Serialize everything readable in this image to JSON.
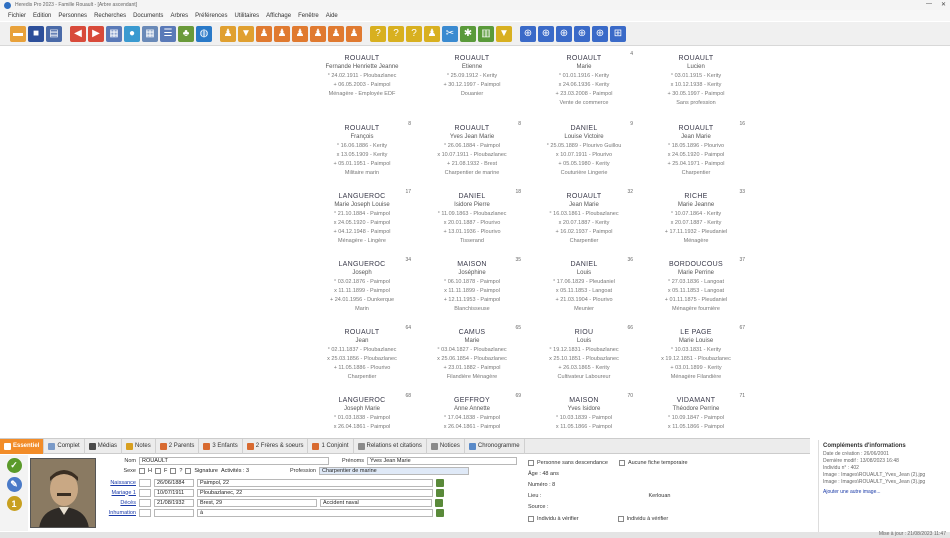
{
  "window": {
    "title": "Heredis Pro 2023 - Famille Rouault - [Arbre ascendant]",
    "minimize": "—",
    "close": "✕"
  },
  "menu": [
    "Fichier",
    "Edition",
    "Personnes",
    "Recherches",
    "Documents",
    "Arbres",
    "Préférences",
    "Utilitaires",
    "Affichage",
    "Fenêtre",
    "Aide"
  ],
  "toolbar": [
    {
      "icon": "open-folder-icon",
      "color": "#e8a13a"
    },
    {
      "icon": "save-icon",
      "color": "#2d4f9a"
    },
    {
      "icon": "print-icon",
      "color": "#4a6aa8"
    },
    {
      "icon": "back-arrow-icon",
      "color": "#d84a3a"
    },
    {
      "icon": "forward-arrow-icon",
      "color": "#d84a3a"
    },
    {
      "icon": "page-icon",
      "color": "#5a7ab8"
    },
    {
      "icon": "globe-icon",
      "color": "#3a9ad0"
    },
    {
      "icon": "grid-icon",
      "color": "#6a8ab8"
    },
    {
      "icon": "list-icon",
      "color": "#5a7ab8"
    },
    {
      "icon": "tree-icon",
      "color": "#6a9a3a"
    },
    {
      "icon": "world-icon",
      "color": "#2a7ac8"
    },
    {
      "icon": "family-icon",
      "color": "#e0a030"
    },
    {
      "icon": "filter-icon",
      "color": "#e0a030"
    },
    {
      "icon": "couple-icon",
      "color": "#e07a30"
    },
    {
      "icon": "couple-icon",
      "color": "#e07a30"
    },
    {
      "icon": "couple-icon",
      "color": "#e07a30"
    },
    {
      "icon": "couple-icon",
      "color": "#e07a30"
    },
    {
      "icon": "couple-icon",
      "color": "#e07a30"
    },
    {
      "icon": "couple-icon",
      "color": "#e07a30"
    },
    {
      "icon": "question-icon",
      "color": "#d8b020"
    },
    {
      "icon": "question-icon",
      "color": "#d8b020"
    },
    {
      "icon": "question-icon",
      "color": "#d8b020"
    },
    {
      "icon": "people-icon",
      "color": "#d8b020"
    },
    {
      "icon": "tools-icon",
      "color": "#3a8ad0"
    },
    {
      "icon": "gear-icon",
      "color": "#5a9a3a"
    },
    {
      "icon": "chart-icon",
      "color": "#5a9a3a"
    },
    {
      "icon": "filter-icon",
      "color": "#d8b020"
    },
    {
      "icon": "zoom-icon",
      "color": "#3a6ac8"
    },
    {
      "icon": "zoom-icon",
      "color": "#3a6ac8"
    },
    {
      "icon": "zoom-icon",
      "color": "#3a6ac8"
    },
    {
      "icon": "zoom-icon",
      "color": "#3a6ac8"
    },
    {
      "icon": "zoom-icon",
      "color": "#3a6ac8"
    },
    {
      "icon": "fit-icon",
      "color": "#3a6ac8"
    }
  ],
  "cards": [
    {
      "name": "ROUAULT",
      "first": "Fernande Henriette Jeanne",
      "lines": [
        "° 24.02.1911 - Ploubazlanec",
        "",
        "+ 06.05.2003 - Paimpol",
        "Ménagère - Employée EDF"
      ],
      "num": ""
    },
    {
      "name": "ROUAULT",
      "first": "Etienne",
      "lines": [
        "° 25.09.1912 - Kerity",
        "",
        "+ 30.12.1997 - Paimpol",
        "Douanier"
      ],
      "num": ""
    },
    {
      "name": "ROUAULT",
      "first": "Marie",
      "lines": [
        "° 01.01.1916 - Kerity",
        "x 24.06.1936 - Kerity",
        "+ 23.03.2008 - Paimpol",
        "Vente de commerce"
      ],
      "num": "4"
    },
    {
      "name": "ROUAULT",
      "first": "Lucien",
      "lines": [
        "° 03.01.1915 - Kerity",
        "x 10.12.1938 - Kerity",
        "+ 30.05.1997 - Paimpol",
        "Sans profession"
      ],
      "num": ""
    },
    {
      "name": "ROUAULT",
      "first": "François",
      "lines": [
        "° 16.06.1886 - Kerity",
        "x 13.05.1909 - Kerity",
        "+ 05.01.1951 - Paimpol",
        "Militaire marin"
      ],
      "num": "8"
    },
    {
      "name": "ROUAULT",
      "first": "Yves Jean Marie",
      "lines": [
        "° 26.06.1884 - Paimpol",
        "x 10.07.1911 - Ploubazlanec",
        "+ 21.08.1932 - Brest",
        "Charpentier de marine"
      ],
      "num": "8"
    },
    {
      "name": "DANIEL",
      "first": "Louise Victoire",
      "lines": [
        "° 25.05.1889 - Plourivo Guillou",
        "x 10.07.1911 - Plourivo",
        "+ 05.05.1980 - Kerity",
        "Couturière Lingerie"
      ],
      "num": "9"
    },
    {
      "name": "ROUAULT",
      "first": "Jean Marie",
      "lines": [
        "° 18.05.1896 - Plourivo",
        "x 24.05.1920 - Paimpol",
        "+ 25.04.1971 - Paimpol",
        "Charpentier"
      ],
      "num": "16"
    },
    {
      "name": "LANGUEROC",
      "first": "Marie Joseph Louise",
      "lines": [
        "° 21.10.1884 - Paimpol",
        "x 24.05.1920 - Paimpol",
        "+ 04.12.1948 - Paimpol",
        "Ménagère - Lingère"
      ],
      "num": "17"
    },
    {
      "name": "DANIEL",
      "first": "Isidore Pierre",
      "lines": [
        "° 11.09.1863 - Ploubazlanec",
        "x 20.01.1887 - Plourivo",
        "+ 13.01.1936 - Plourivo",
        "Tisserand"
      ],
      "num": "18"
    },
    {
      "name": "ROUAULT",
      "first": "Jean Marie",
      "lines": [
        "° 16.03.1861 - Ploubazlanec",
        "x 20.07.1887 - Kerity",
        "+ 16.02.1937 - Paimpol",
        "Charpentier"
      ],
      "num": "32"
    },
    {
      "name": "RICHE",
      "first": "Marie Jeanne",
      "lines": [
        "° 10.07.1864 - Kerity",
        "x 20.07.1887 - Kerity",
        "+ 17.11.1932 - Pleudaniel",
        "Ménagère"
      ],
      "num": "33"
    },
    {
      "name": "LANGUEROC",
      "first": "Joseph",
      "lines": [
        "° 03.02.1876 - Paimpol",
        "x 11.11.1899 - Paimpol",
        "+ 24.01.1956 - Dunkerque",
        "Marin"
      ],
      "num": "34"
    },
    {
      "name": "MAISON",
      "first": "Joséphine",
      "lines": [
        "° 06.10.1878 - Paimpol",
        "x 11.11.1899 - Paimpol",
        "+ 12.11.1953 - Paimpol",
        "Blanchisseuse"
      ],
      "num": "35"
    },
    {
      "name": "DANIEL",
      "first": "Louis",
      "lines": [
        "° 17.06.1829 - Pleudaniel",
        "x 05.11.1853 - Langoat",
        "+ 21.03.1904 - Plourivo",
        "Meunier"
      ],
      "num": "36"
    },
    {
      "name": "BORDOUCOUS",
      "first": "Marie Perrine",
      "lines": [
        "° 27.03.1836 - Langoat",
        "x 05.11.1853 - Langoat",
        "+ 01.11.1875 - Pleudaniel",
        "Ménagère fournière"
      ],
      "num": "37"
    },
    {
      "name": "ROUAULT",
      "first": "Jean",
      "lines": [
        "° 02.11.1837 - Ploubazlanec",
        "x 25.03.1856 - Ploubazlanec",
        "+ 11.05.1886 - Plourivo",
        "Charpentier"
      ],
      "num": "64"
    },
    {
      "name": "CAMUS",
      "first": "Marie",
      "lines": [
        "° 03.04.1827 - Ploubazlanec",
        "x 25.06.1854 - Ploubazlanec",
        "+ 23.01.1882 - Paimpol",
        "Filandière Ménagère"
      ],
      "num": "65"
    },
    {
      "name": "RIOU",
      "first": "Louis",
      "lines": [
        "° 19.12.1831 - Ploubazlanec",
        "x 25.10.1851 - Ploubazlanec",
        "+ 26.03.1865 - Kerity",
        "Cultivateur Laboureur"
      ],
      "num": "66"
    },
    {
      "name": "LE PAGE",
      "first": "Marie Louise",
      "lines": [
        "° 10.03.1831 - Kerity",
        "x 19.12.1851 - Ploubazlanec",
        "+ 03.01.1899 - Kerity",
        "Ménagère Filandière"
      ],
      "num": "67"
    },
    {
      "name": "LANGUEROC",
      "first": "Joseph Marie",
      "lines": [
        "° 01.03.1838 - Paimpol",
        "x 26.04.1861 - Paimpol"
      ],
      "num": "68"
    },
    {
      "name": "GEFFROY",
      "first": "Anne Annette",
      "lines": [
        "° 17.04.1838 - Paimpol",
        "x 26.04.1861 - Paimpol"
      ],
      "num": "69"
    },
    {
      "name": "MAISON",
      "first": "Yves Isidore",
      "lines": [
        "° 10.03.1839 - Paimpol",
        "x 11.05.1866 - Paimpol"
      ],
      "num": "70"
    },
    {
      "name": "VIDAMANT",
      "first": "Théodore Perrine",
      "lines": [
        "° 10.09.1847 - Paimpol",
        "x 11.05.1866 - Paimpol"
      ],
      "num": "71"
    }
  ],
  "tabs": [
    {
      "label": "Essentiel",
      "color": "#f28c28",
      "active": true
    },
    {
      "label": "Complet",
      "color": "#7a9ac8",
      "active": false
    },
    {
      "label": "Médias",
      "color": "#4a4a4a",
      "active": false
    },
    {
      "label": "Notes",
      "color": "#d8a020",
      "active": false
    },
    {
      "label": "2 Parents",
      "color": "#d86a30",
      "active": false
    },
    {
      "label": "3 Enfants",
      "color": "#d86a30",
      "active": false
    },
    {
      "label": "2 Frères & soeurs",
      "color": "#d86a30",
      "active": false
    },
    {
      "label": "1 Conjoint",
      "color": "#d86a30",
      "active": false
    },
    {
      "label": "Relations et citations",
      "color": "#8a8a8a",
      "active": false
    },
    {
      "label": "Notices",
      "color": "#8a8a8a",
      "active": false
    },
    {
      "label": "Chronogramme",
      "color": "#5a8ac8",
      "active": false
    }
  ],
  "left_strip": [
    {
      "icon": "check-icon",
      "glyph": "✓",
      "color": "#5a9a2a"
    },
    {
      "icon": "edit-icon",
      "glyph": "✎",
      "color": "#4a7ac8"
    },
    {
      "icon": "number-one-icon",
      "glyph": "1",
      "color": "#c8a020"
    }
  ],
  "form": {
    "nom_label": "Nom",
    "nom_value": "ROUAULT",
    "prenoms_label": "Prénoms",
    "prenoms_value": "Yves Jean Marie",
    "sexe_label": "Sexe",
    "sexe_h": "H",
    "sexe_f": "F",
    "sexe_i": "?",
    "signature_label": "Signature",
    "activites": "Activités : 3",
    "profession_label": "Profession",
    "profession_value": "Charpentier de marine",
    "naissance_label": "Naissance",
    "naissance_date": "26/06/1884",
    "naissance_lieu": "Paimpol, 22",
    "mariage_label": "Mariage 1",
    "mariage_date": "10/07/1911",
    "mariage_lieu": "Ploubazlanec, 22",
    "deces_label": "Décès",
    "deces_date": "21/08/1932",
    "deces_lieu": "Brest, 29",
    "deces_extra": "Accident naval",
    "inhumation_label": "Inhumation",
    "inhumation_value": "à"
  },
  "mid": {
    "opt1": "Personne sans descendance",
    "opt2": "Aucune fiche temporaire",
    "age": "Âge : 48 ans",
    "numero": "Numéro : 8",
    "notes": "Notes :",
    "lieu": "Lieu :",
    "lieu_value": "Kerlouan",
    "source": "Source :",
    "link1": "Individu à vérifier",
    "link2": "Individu à vérifier"
  },
  "right": {
    "heading": "Compléments d'informations",
    "lines": [
      "Date de création : 26/06/2001",
      "Dernière modif : 13/08/2023 16:48",
      "Individu n° : 402",
      "Image : Images\\ROUAULT_Yves_Jean (2).jpg",
      "Image : Images\\ROUAULT_Yves_Jean (3).jpg"
    ],
    "link": "Ajouter une autre image..."
  },
  "status": {
    "date": "Mise à jour : 21/08/2023 11:47"
  }
}
